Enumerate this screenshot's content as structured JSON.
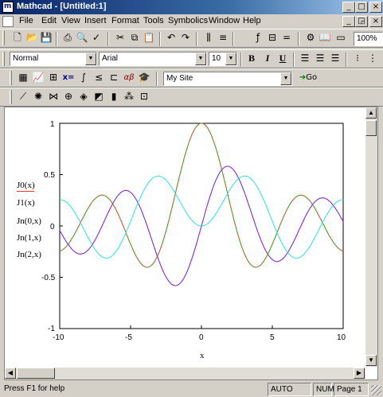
{
  "window": {
    "app_icon_letter": "m",
    "title": "Mathcad - [Untitled:1]",
    "controls": [
      "_",
      "□",
      "×"
    ]
  },
  "menubar": {
    "items": [
      "File",
      "Edit",
      "View",
      "Insert",
      "Format",
      "Tools",
      "Symbolics",
      "Window",
      "Help"
    ],
    "doc_controls": [
      "_",
      "◲",
      "×"
    ]
  },
  "toolbar_standard": {
    "zoom": "100%"
  },
  "toolbar_format": {
    "style": "Normal",
    "font": "Arial",
    "size": "10",
    "bold": "B",
    "italic": "I",
    "underline": "U"
  },
  "toolbar_math": {
    "xequals": "x=",
    "alpha_beta": "αβ",
    "resource": "My Site",
    "go": "Go"
  },
  "plot": {
    "y_labels": [
      "J0(x)",
      "J1(x)",
      "Jn(0,x)",
      "Jn(1,x)",
      "Jn(2,x)"
    ],
    "x_label": "x",
    "y_ticks": [
      "1",
      "0.5",
      "0",
      "-0.5",
      "-1"
    ],
    "x_ticks": [
      "-10",
      "-5",
      "0",
      "5",
      "10"
    ]
  },
  "chart_data": {
    "type": "line",
    "title": "",
    "xlabel": "x",
    "ylabel": "",
    "xlim": [
      -10,
      10
    ],
    "ylim": [
      -1,
      1
    ],
    "grid": false,
    "series": [
      {
        "name": "J0(x)",
        "color": "#ff3030",
        "dash": "solid",
        "x": [
          -10,
          -8,
          -6,
          -4,
          -2,
          0,
          2,
          4,
          6,
          8,
          10
        ],
        "values": [
          -0.246,
          0.172,
          0.151,
          -0.397,
          0.224,
          1.0,
          0.224,
          -0.397,
          0.151,
          0.172,
          -0.246
        ]
      },
      {
        "name": "J1(x)",
        "color": "#3a3acf",
        "dash": "solid",
        "x": [
          -10,
          -8,
          -6,
          -4,
          -2,
          0,
          2,
          4,
          6,
          8,
          10
        ],
        "values": [
          -0.043,
          -0.235,
          0.277,
          0.066,
          -0.577,
          0.0,
          0.577,
          -0.066,
          -0.277,
          0.235,
          0.043
        ]
      },
      {
        "name": "Jn(0,x)",
        "color": "#22c022",
        "dash": "dash",
        "x": [
          -10,
          -8,
          -6,
          -4,
          -2,
          0,
          2,
          4,
          6,
          8,
          10
        ],
        "values": [
          -0.246,
          0.172,
          0.151,
          -0.397,
          0.224,
          1.0,
          0.224,
          -0.397,
          0.151,
          0.172,
          -0.246
        ]
      },
      {
        "name": "Jn(1,x)",
        "color": "#c020c0",
        "dash": "dash",
        "x": [
          -10,
          -8,
          -6,
          -4,
          -2,
          0,
          2,
          4,
          6,
          8,
          10
        ],
        "values": [
          -0.043,
          -0.235,
          0.277,
          0.066,
          -0.577,
          0.0,
          0.577,
          -0.066,
          -0.277,
          0.235,
          0.043
        ]
      },
      {
        "name": "Jn(2,x)",
        "color": "#30e0e0",
        "dash": "solid",
        "x": [
          -10,
          -8,
          -6,
          -4,
          -2,
          0,
          2,
          4,
          6,
          8,
          10
        ],
        "values": [
          0.255,
          -0.113,
          -0.243,
          0.364,
          0.353,
          0.0,
          0.353,
          0.364,
          -0.243,
          -0.113,
          0.255
        ]
      }
    ]
  },
  "statusbar": {
    "help": "Press F1 for help",
    "mode": "AUTO",
    "num": "NUM",
    "page": "Page 1"
  }
}
